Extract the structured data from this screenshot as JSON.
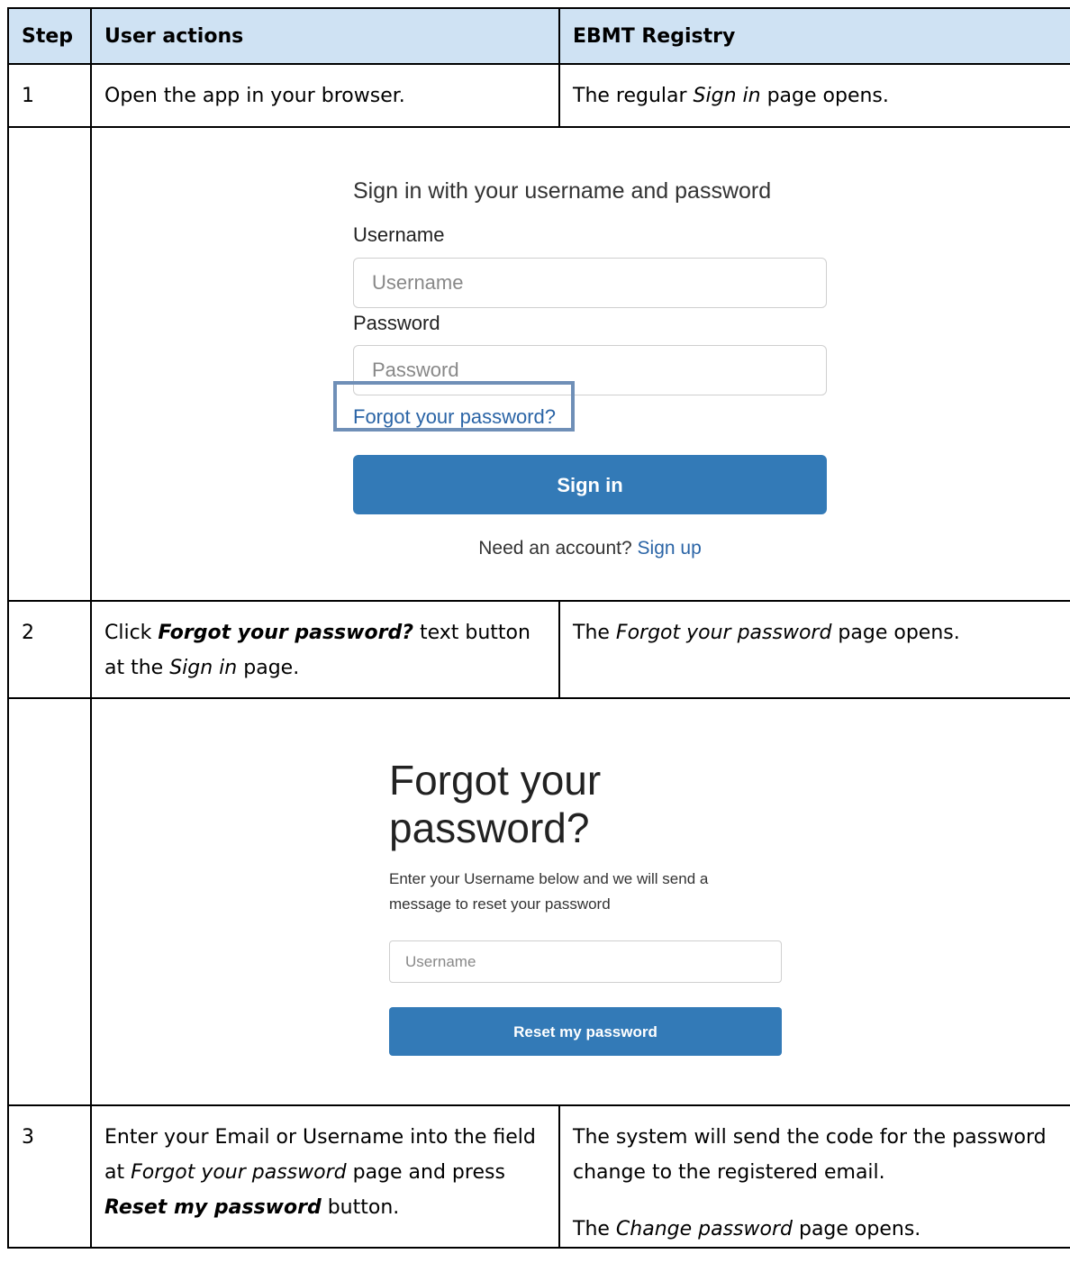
{
  "table": {
    "headers": [
      "Step",
      "User actions",
      "EBMT Registry"
    ],
    "row1": {
      "step": "1",
      "action": "Open the app in your browser.",
      "result_pre": "The regular ",
      "result_em": "Sign in",
      "result_post": " page opens."
    },
    "row2": {
      "step": "2",
      "action_pre": "Click ",
      "action_bi": "Forgot your password?",
      "action_mid": " text button at the ",
      "action_em": "Sign in",
      "action_post": " page.",
      "result_pre": "The ",
      "result_em": "Forgot your password",
      "result_post": " page opens."
    },
    "row3": {
      "step": "3",
      "action_pre": "Enter your Email or Username into the field at ",
      "action_em": "Forgot your password",
      "action_mid": " page and press ",
      "action_bi": "Reset my password",
      "action_post": " button.",
      "result1": "The system will send the code for the password change to the registered email.",
      "result2_pre": "The ",
      "result2_em": "Change password",
      "result2_post": " page opens."
    }
  },
  "signin_screen": {
    "title": "Sign in with your username and password",
    "username_label": "Username",
    "username_placeholder": "Username",
    "password_label": "Password",
    "password_placeholder": "Password",
    "forgot_link": "Forgot your password?",
    "signin_button": "Sign in",
    "need_account": "Need an account?",
    "signup_link": "Sign up"
  },
  "forgot_screen": {
    "title_line1": "Forgot your",
    "title_line2": "password?",
    "description_line1": "Enter your Username below and we will send a",
    "description_line2": "message to reset your password",
    "username_placeholder": "Username",
    "reset_button": "Reset my password"
  },
  "colors": {
    "header_bg": "#cfe2f3",
    "button_bg": "#337ab7",
    "link": "#2a64a6",
    "highlight": "#6f8fb7"
  }
}
